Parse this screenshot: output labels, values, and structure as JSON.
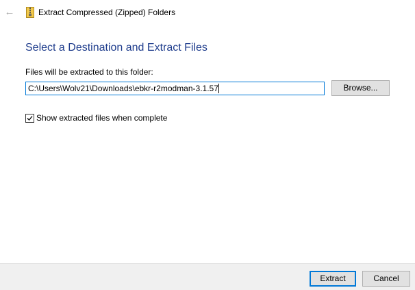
{
  "titlebar": {
    "back_icon": "back-arrow-icon",
    "app_icon": "zip-folder-icon",
    "title": "Extract Compressed (Zipped) Folders"
  },
  "main": {
    "heading": "Select a Destination and Extract Files",
    "destination_label": "Files will be extracted to this folder:",
    "destination_path": "C:\\Users\\Wolv21\\Downloads\\ebkr-r2modman-3.1.57",
    "browse_label": "Browse...",
    "show_files_label": "Show extracted files when complete",
    "show_files_checked": true
  },
  "footer": {
    "extract_label": "Extract",
    "cancel_label": "Cancel"
  },
  "colors": {
    "heading": "#1e3c8c",
    "focus_border": "#0078d7",
    "footer_bg": "#f0f0f0",
    "button_bg": "#e1e1e1"
  }
}
